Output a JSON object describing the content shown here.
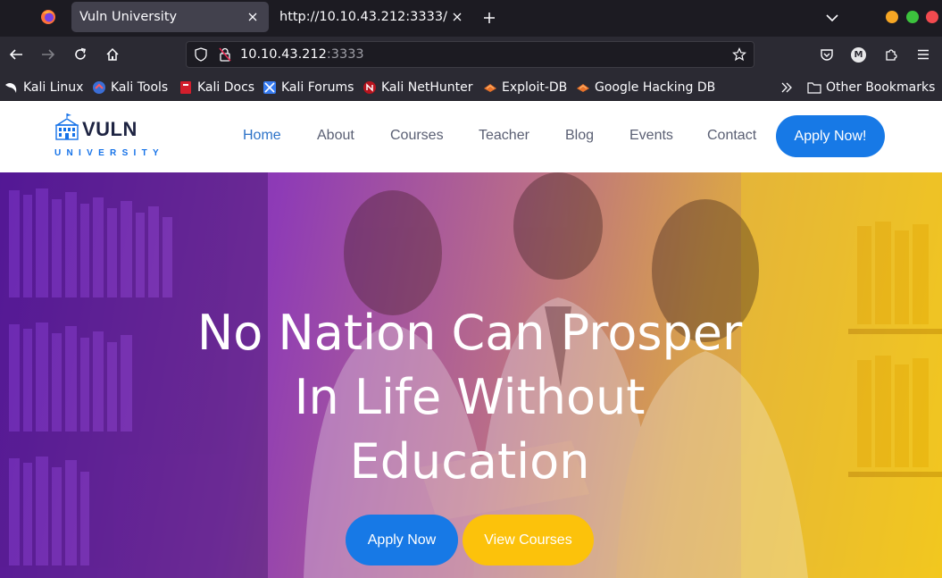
{
  "browser": {
    "tabs": [
      {
        "title": "Vuln University",
        "active": true
      },
      {
        "title": "http://10.10.43.212:3333/",
        "active": false
      }
    ],
    "url": {
      "host": "10.10.43.212",
      "port": ":3333"
    },
    "profile_initial": "M",
    "bookmarks": [
      {
        "label": "Kali Linux",
        "icon": "kali-dragon-icon"
      },
      {
        "label": "Kali Tools",
        "icon": "kali-tools-icon"
      },
      {
        "label": "Kali Docs",
        "icon": "kali-docs-icon"
      },
      {
        "label": "Kali Forums",
        "icon": "kali-forums-icon"
      },
      {
        "label": "Kali NetHunter",
        "icon": "kali-nethunter-icon"
      },
      {
        "label": "Exploit-DB",
        "icon": "exploit-db-icon"
      },
      {
        "label": "Google Hacking DB",
        "icon": "ghdb-icon"
      }
    ],
    "other_bookmarks": "Other Bookmarks"
  },
  "site": {
    "logo": {
      "name": "VULN",
      "subtitle": "UNIVERSITY"
    },
    "menu": [
      "Home",
      "About",
      "Courses",
      "Teacher",
      "Blog",
      "Events",
      "Contact"
    ],
    "active_menu": "Home",
    "apply_button": "Apply Now!",
    "hero": {
      "title_lines": [
        "No Nation Can Prosper",
        "In Life Without",
        "Education"
      ],
      "primary_button": "Apply Now",
      "secondary_button": "View Courses"
    }
  },
  "colors": {
    "accent_blue": "#1779e6",
    "accent_yellow": "#fcc20b",
    "gradient_start": "#6a1fb8",
    "gradient_end": "#f1c21c"
  }
}
